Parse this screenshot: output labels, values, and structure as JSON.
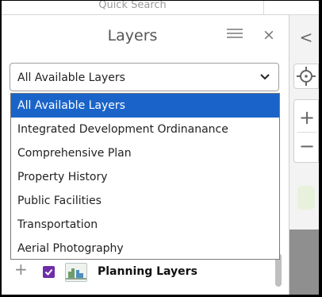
{
  "header": {
    "quick_search_label": "Quick Search"
  },
  "panel": {
    "title": "Layers",
    "close_label": "×",
    "select": {
      "selected_value": "All Available Layers",
      "options": [
        "All Available Layers",
        "Integrated Development Ordinanance",
        "Comprehensive Plan",
        "Property History",
        "Public Facilities",
        "Transportation",
        "Aerial Photography"
      ]
    },
    "layer_row": {
      "expand_label": "+",
      "name": "Planning Layers",
      "checked": true
    }
  },
  "toolbar": {
    "collapse_label": "<",
    "zoom_in_label": "+",
    "zoom_out_label": "−"
  },
  "colors": {
    "selected_option_bg": "#1a64c9",
    "checkbox_purple": "#6f2da8"
  }
}
